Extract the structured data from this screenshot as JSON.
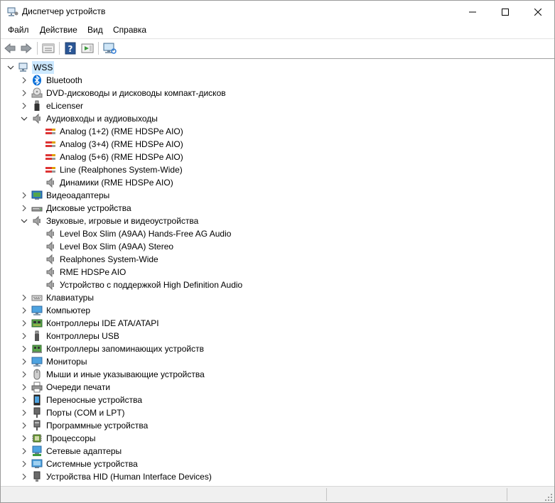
{
  "window": {
    "title": "Диспетчер устройств"
  },
  "menu": [
    "Файл",
    "Действие",
    "Вид",
    "Справка"
  ],
  "tree": {
    "root": "WSS",
    "categories": [
      {
        "label": "Bluetooth",
        "icon": "bluetooth-icon",
        "expanded": false
      },
      {
        "label": "DVD-дисководы и дисководы компакт-дисков",
        "icon": "dvd-drive-icon",
        "expanded": false
      },
      {
        "label": "eLicenser",
        "icon": "usb-key-icon",
        "expanded": false
      },
      {
        "label": "Аудиовходы и аудиовыходы",
        "icon": "speaker-icon",
        "expanded": true,
        "children": [
          {
            "label": "Analog (1+2) (RME HDSPe AIO)",
            "icon": "audio-cable-icon"
          },
          {
            "label": "Analog (3+4) (RME HDSPe AIO)",
            "icon": "audio-cable-icon"
          },
          {
            "label": "Analog (5+6) (RME HDSPe AIO)",
            "icon": "audio-cable-icon"
          },
          {
            "label": "Line (Realphones System-Wide)",
            "icon": "audio-cable-icon"
          },
          {
            "label": "Динамики (RME HDSPe AIO)",
            "icon": "speaker-icon"
          }
        ]
      },
      {
        "label": "Видеоадаптеры",
        "icon": "display-adapter-icon",
        "expanded": false
      },
      {
        "label": "Дисковые устройства",
        "icon": "disk-drive-icon",
        "expanded": false
      },
      {
        "label": "Звуковые, игровые и видеоустройства",
        "icon": "speaker-icon",
        "expanded": true,
        "children": [
          {
            "label": "Level Box Slim (A9AA) Hands-Free AG Audio",
            "icon": "speaker-icon"
          },
          {
            "label": "Level Box Slim (A9AA) Stereo",
            "icon": "speaker-icon"
          },
          {
            "label": "Realphones System-Wide",
            "icon": "speaker-icon"
          },
          {
            "label": "RME HDSPe AIO",
            "icon": "speaker-icon"
          },
          {
            "label": "Устройство с поддержкой High Definition Audio",
            "icon": "speaker-icon"
          }
        ]
      },
      {
        "label": "Клавиатуры",
        "icon": "keyboard-icon",
        "expanded": false
      },
      {
        "label": "Компьютер",
        "icon": "computer-icon",
        "expanded": false
      },
      {
        "label": "Контроллеры IDE ATA/ATAPI",
        "icon": "ide-controller-icon",
        "expanded": false
      },
      {
        "label": "Контроллеры USB",
        "icon": "usb-controller-icon",
        "expanded": false
      },
      {
        "label": "Контроллеры запоминающих устройств",
        "icon": "storage-controller-icon",
        "expanded": false
      },
      {
        "label": "Мониторы",
        "icon": "monitor-icon",
        "expanded": false
      },
      {
        "label": "Мыши и иные указывающие устройства",
        "icon": "mouse-icon",
        "expanded": false
      },
      {
        "label": "Очереди печати",
        "icon": "printer-icon",
        "expanded": false
      },
      {
        "label": "Переносные устройства",
        "icon": "portable-device-icon",
        "expanded": false
      },
      {
        "label": "Порты (COM и LPT)",
        "icon": "port-icon",
        "expanded": false
      },
      {
        "label": "Программные устройства",
        "icon": "software-device-icon",
        "expanded": false
      },
      {
        "label": "Процессоры",
        "icon": "processor-icon",
        "expanded": false
      },
      {
        "label": "Сетевые адаптеры",
        "icon": "network-adapter-icon",
        "expanded": false
      },
      {
        "label": "Системные устройства",
        "icon": "system-device-icon",
        "expanded": false
      },
      {
        "label": "Устройства HID (Human Interface Devices)",
        "icon": "hid-device-icon",
        "expanded": false
      }
    ]
  },
  "colors": {
    "selection": "#cce8ff",
    "help_blue": "#2b5797",
    "accent": "#0078d7"
  }
}
